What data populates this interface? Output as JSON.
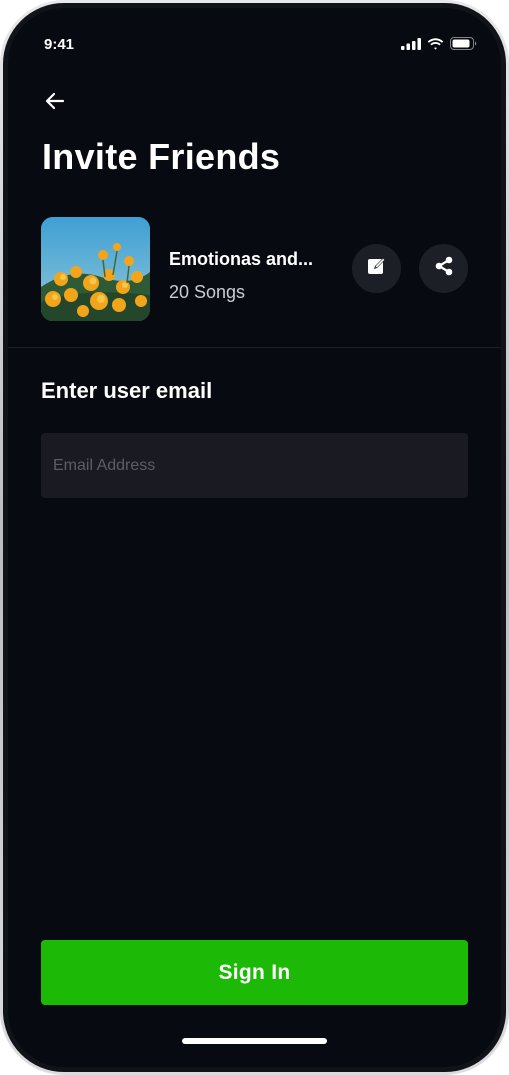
{
  "status_bar": {
    "time": "9:41",
    "signal_icon": "cellular-signal-icon",
    "wifi_icon": "wifi-icon",
    "battery_icon": "battery-icon"
  },
  "header": {
    "back_icon": "arrow-left-icon",
    "title": "Invite Friends"
  },
  "playlist": {
    "name": "Emotionas and...",
    "song_count": "20 Songs",
    "edit_icon": "edit-icon",
    "share_icon": "share-icon"
  },
  "invite_form": {
    "label": "Enter user email",
    "email_value": "",
    "email_placeholder": "Email Address"
  },
  "actions": {
    "sign_in_label": "Sign In"
  },
  "colors": {
    "background": "#070a11",
    "field": "#1a1b22",
    "accent": "#1db907",
    "icon_button": "#1d1f26"
  }
}
